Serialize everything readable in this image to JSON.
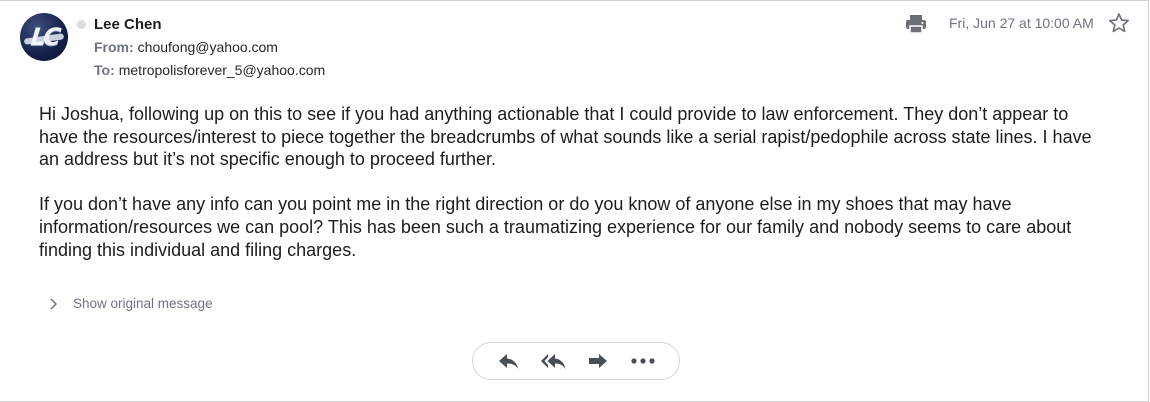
{
  "sender": {
    "name": "Lee Chen",
    "avatar_text": "LC",
    "from_label": "From:",
    "from_address": "choufong@yahoo.com",
    "to_label": "To:",
    "to_address": "metropolisforever_5@yahoo.com"
  },
  "date": "Fri, Jun 27 at 10:00 AM",
  "body": {
    "paragraph_1": "Hi Joshua, following up on this to see if you had anything actionable that I could provide to law enforcement. They don’t appear to have the resources/interest to piece together the breadcrumbs of what sounds like a serial rapist/pedophile across state lines. I have an address but it’s not specific enough to proceed further.",
    "paragraph_2": "If you don’t have any info can you point me in the right direction or do you know of anyone else in my shoes that may have information/resources we can pool? This has been such a traumatizing experience for our family and nobody seems to care about finding this individual and filing charges."
  },
  "show_original": "Show original message",
  "icons": {
    "print": "print-icon",
    "star": "star-icon",
    "reply": "reply-icon",
    "reply_all": "reply-all-icon",
    "forward": "forward-icon",
    "more": "more-icon",
    "chevron": "chevron-right-icon"
  },
  "colors": {
    "text": "#1d1d1f",
    "muted": "#6e7480",
    "icon": "#5b5f66",
    "avatar_bg": "#14204a"
  }
}
